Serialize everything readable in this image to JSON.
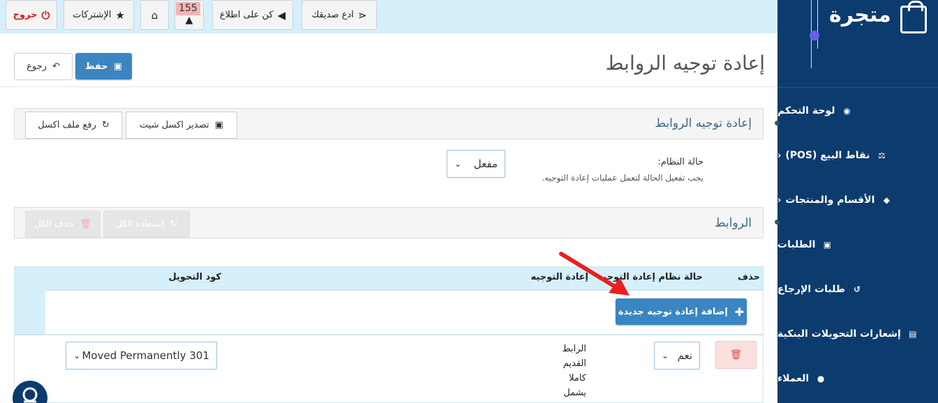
{
  "sidebar": {
    "logo_text": "متجرة",
    "items": [
      {
        "label": "لوحة التحكم",
        "icon": "dashboard-icon",
        "glyph": "◉",
        "has_chevron": false
      },
      {
        "label": "نقاط البيع (POS)",
        "icon": "scale-icon",
        "glyph": "⚖",
        "has_chevron": true
      },
      {
        "label": "الأقسام والمنتجات",
        "icon": "tag-icon",
        "glyph": "◆",
        "has_chevron": true
      },
      {
        "label": "الطلبات",
        "icon": "cart-icon",
        "glyph": "▣",
        "has_chevron": false
      },
      {
        "label": "طلبات الإرجاع",
        "icon": "undo-icon",
        "glyph": "↺",
        "has_chevron": false
      },
      {
        "label": "إشعارات التحويلات البنكية",
        "icon": "money-icon",
        "glyph": "▤",
        "has_chevron": false
      },
      {
        "label": "العملاء",
        "icon": "user-icon",
        "glyph": "●",
        "has_chevron": false
      }
    ]
  },
  "topbar": {
    "invite_label": "ادع صديقك",
    "news_label": "كن على اطلاع",
    "notif_count": "155",
    "subscriptions_label": "الإشتركات",
    "logout_label": "خروج"
  },
  "header": {
    "title": "إعادة توجيه الروابط",
    "save_label": "حفظ",
    "back_label": "رجوع"
  },
  "redirect_panel": {
    "title": "إعادة توجيه الروابط",
    "export_label": "تصدير اكسل شيت",
    "upload_label": "رفع ملف اكسل",
    "status_label": "حالة النظام:",
    "status_help": "يجب تفعيل الحالة لتعمل عمليات إعادة التوجيه.",
    "status_value": "مفعل"
  },
  "links_panel": {
    "title": "الروابط",
    "restore_all_label": "إستعادة الكل",
    "delete_all_label": "حذف الكل"
  },
  "table": {
    "headers": {
      "delete": "حذف",
      "system_status": "حالة نظام إعادة التوجيه",
      "redirect": "إعادة التوجيه",
      "code": "كود التحويل"
    },
    "add_label": "إضافة إعادة توجيه جديدة",
    "rows": [
      {
        "status": "نعم",
        "old_url_text": "الرابط القديم كاملا يشمل",
        "code": "Moved Permanently 301"
      }
    ]
  }
}
